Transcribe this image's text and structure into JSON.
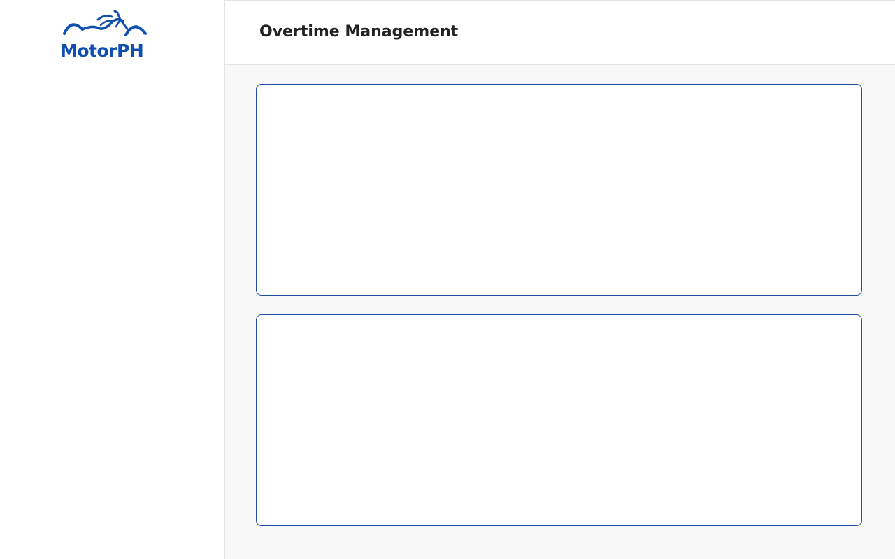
{
  "brand": {
    "name": "MotorPH",
    "logo_icon": "motorcycle-icon",
    "color": "#0f4fb0"
  },
  "header": {
    "title": "Overtime Management"
  },
  "colors": {
    "panel_border": "#1f4fa3",
    "main_background": "#f8f8f8"
  }
}
